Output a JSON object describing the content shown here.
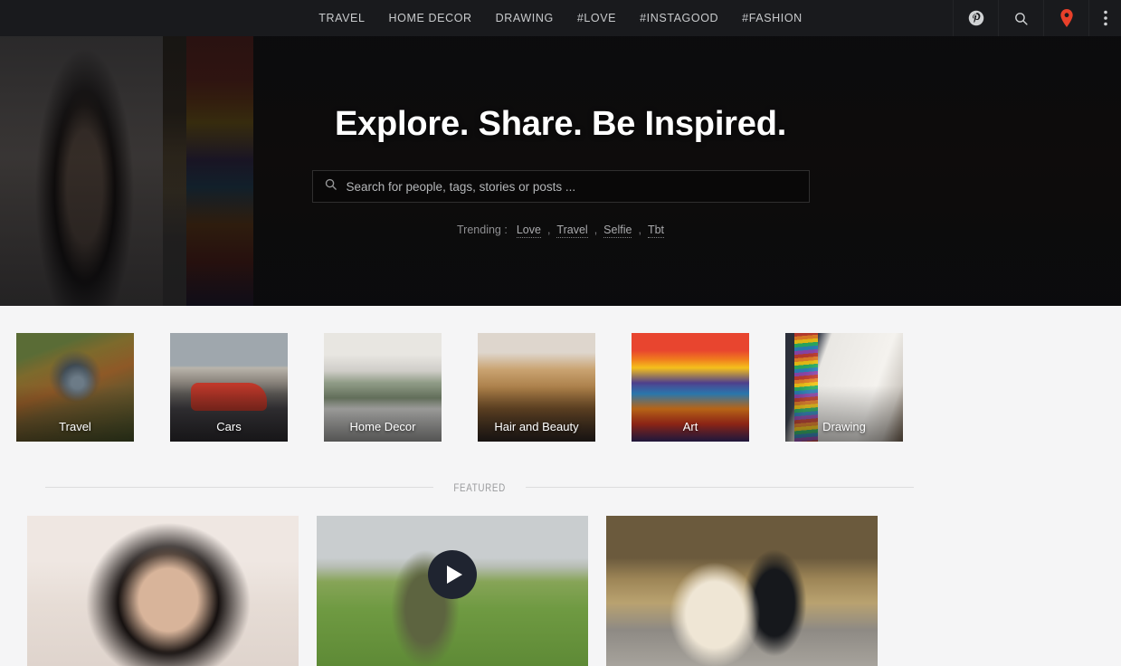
{
  "header": {
    "nav": [
      {
        "label": "TRAVEL"
      },
      {
        "label": "HOME DECOR"
      },
      {
        "label": "DRAWING"
      },
      {
        "label": "#LOVE"
      },
      {
        "label": "#INSTAGOOD"
      },
      {
        "label": "#FASHION"
      }
    ],
    "icons": [
      {
        "name": "pinterest-icon"
      },
      {
        "name": "search-icon"
      },
      {
        "name": "location-pin-icon",
        "color": "#e8402a"
      },
      {
        "name": "more-vertical-icon"
      }
    ],
    "background": "#191a1d"
  },
  "hero": {
    "title": "Explore. Share. Be Inspired.",
    "search": {
      "placeholder": "Search for people, tags, stories or posts ...",
      "value": ""
    },
    "trending": {
      "label": "Trending :",
      "separator": ",",
      "items": [
        "Love",
        "Travel",
        "Selfie",
        "Tbt"
      ]
    }
  },
  "categories": [
    {
      "label": "Travel",
      "image": "img-travel"
    },
    {
      "label": "Cars",
      "image": "img-cars"
    },
    {
      "label": "Home Decor",
      "image": "img-home"
    },
    {
      "label": "Hair and Beauty",
      "image": "img-hair"
    },
    {
      "label": "Art",
      "image": "img-art"
    },
    {
      "label": "Drawing",
      "image": "img-drawing"
    }
  ],
  "featured": {
    "section_label": "FEATURED",
    "cards": [
      {
        "name": "featured-card-woman-with-mug",
        "image": "img-woman",
        "has_video": false
      },
      {
        "name": "featured-card-soldier-video",
        "image": "img-soldier",
        "has_video": true
      },
      {
        "name": "featured-card-man-with-dog",
        "image": "img-dog",
        "has_video": false
      }
    ]
  }
}
